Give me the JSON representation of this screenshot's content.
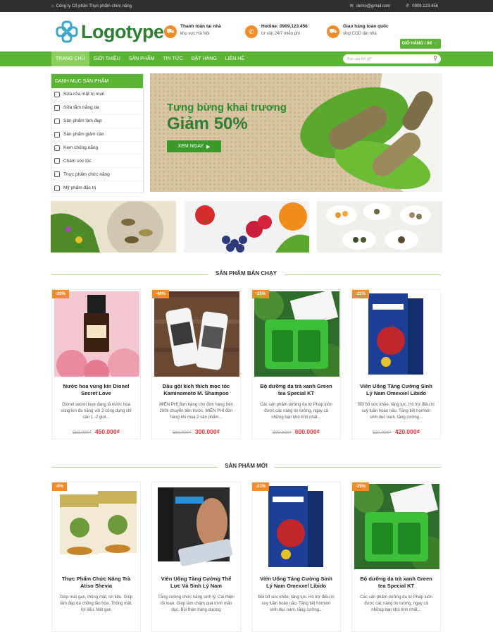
{
  "topbar": {
    "company": "Công ty Cổ phần Thực phẩm chức năng",
    "email": "demo@gmail.com",
    "phone": "0909.123.456"
  },
  "header": {
    "logo": "Logotype",
    "info": [
      {
        "icon": "truck-icon",
        "title": "Thanh toán tại nhà",
        "sub": "khu vực Hà Nội"
      },
      {
        "icon": "phone-icon",
        "title": "Hotline: 0909.123.456",
        "sub": "tư vấn 24/7 miễn phí"
      },
      {
        "icon": "truck-icon",
        "title": "Giao hàng toàn quốc",
        "sub": "ship COD tận nhà"
      }
    ],
    "cart": "GIỎ HÀNG / 0đ"
  },
  "nav": {
    "items": [
      "TRANG CHỦ",
      "GIỚI THIỆU",
      "SẢN PHẨM",
      "TIN TỨC",
      "ĐẶT HÀNG",
      "LIÊN HỆ"
    ],
    "search_placeholder": "Bạn cần tìm gì?"
  },
  "sidebar": {
    "title": "DANH MỤC SẢN PHẨM",
    "items": [
      "Sữa rửa mặt trị mụn",
      "Sữa tắm trắng da",
      "Sản phẩm làm đẹp",
      "Sản phẩm giảm cân",
      "Kem chống nắng",
      "Chăm sóc tóc",
      "Thực phẩm chức năng",
      "Mỹ phẩm đặc trị"
    ]
  },
  "banner": {
    "line1": "Tưng bừng khai trương",
    "line2": "Giảm 50%",
    "button": "XEM NGAY"
  },
  "sections": {
    "bestseller": "SẢN PHẨM BÁN CHẠY",
    "new": "SẢN PHẨM MỚI"
  },
  "bestseller": [
    {
      "badge": "-20%",
      "name": "Nước hoa vùng kín Dionel Secret Love",
      "desc": "Dionel secret love đang là nước hoa vùng kín đa năng với 2 công dụng chỉ cần 1 -2 giọt...",
      "old": "560.000₫",
      "new": "450.000₫"
    },
    {
      "badge": "-46%",
      "name": "Dầu gội kích thích mọc tóc Kaminomoto M. Shampoo",
      "desc": "MIỄN PHÍ đơn hàng cho đơn hàng trên 200k chuyển tiền trước. MIỄN PHÍ đơn hàng khi mua 2 sản phẩm...",
      "old": "560.000₫",
      "new": "300.000₫"
    },
    {
      "badge": "-25%",
      "name": "Bộ dưỡng da trà xanh Green tea Special KT",
      "desc": "Các sản phẩm dưỡng da từ Pháp luôn được các nàng tin tưởng, ngay cả những bạn khó tính nhất...",
      "old": "800.000₫",
      "new": "600.000₫"
    },
    {
      "badge": "-21%",
      "name": "Viên Uống Tăng Cường Sinh Lý Nam Omexxel Libido",
      "desc": "Bồi bổ sức khỏe, tăng lực. Hỗ trợ điều trị suy tuần hoàn não. Tăng tiết hormon sinh dục nam, tăng cường...",
      "old": "530.000₫",
      "new": "420.000₫"
    }
  ],
  "newproducts": [
    {
      "badge": "-8%",
      "name": "Thực Phẩm Chức Năng Trà Atiso Shevia",
      "desc": "Giúp mát gan, thông mật, lợi tiểu. Giúp làm đẹp da chống lão hóa. Thông mật, lợi tiểu. Mát gan",
      "old": "",
      "new": ""
    },
    {
      "badge": "",
      "name": "Viên Uống Tăng Cường Thể Lực Và Sinh Lý Nam",
      "desc": "Tăng cường chức năng sinh lý. Cải thiện rối loạn. Giúp làm chậm quá trình mãn dục. Bồi thận tráng dương",
      "old": "",
      "new": ""
    },
    {
      "badge": "-21%",
      "name": "Viên Uống Tăng Cường Sinh Lý Nam Omexxel Libido",
      "desc": "Bồi bổ sức khỏe, tăng lực. Hỗ trợ điều trị suy tuần hoàn não. Tăng tiết hormon sinh dục nam, tăng cường...",
      "old": "",
      "new": ""
    },
    {
      "badge": "-25%",
      "name": "Bộ dưỡng da trà xanh Green tea Special KT",
      "desc": "Các sản phẩm dưỡng da từ Pháp luôn được các nàng tin tưởng, ngay cả những bạn khó tính nhất...",
      "old": "",
      "new": ""
    }
  ],
  "colors": {
    "brand_green": "#5cb532",
    "accent_orange": "#f08c2a",
    "price_red": "#e53935"
  }
}
